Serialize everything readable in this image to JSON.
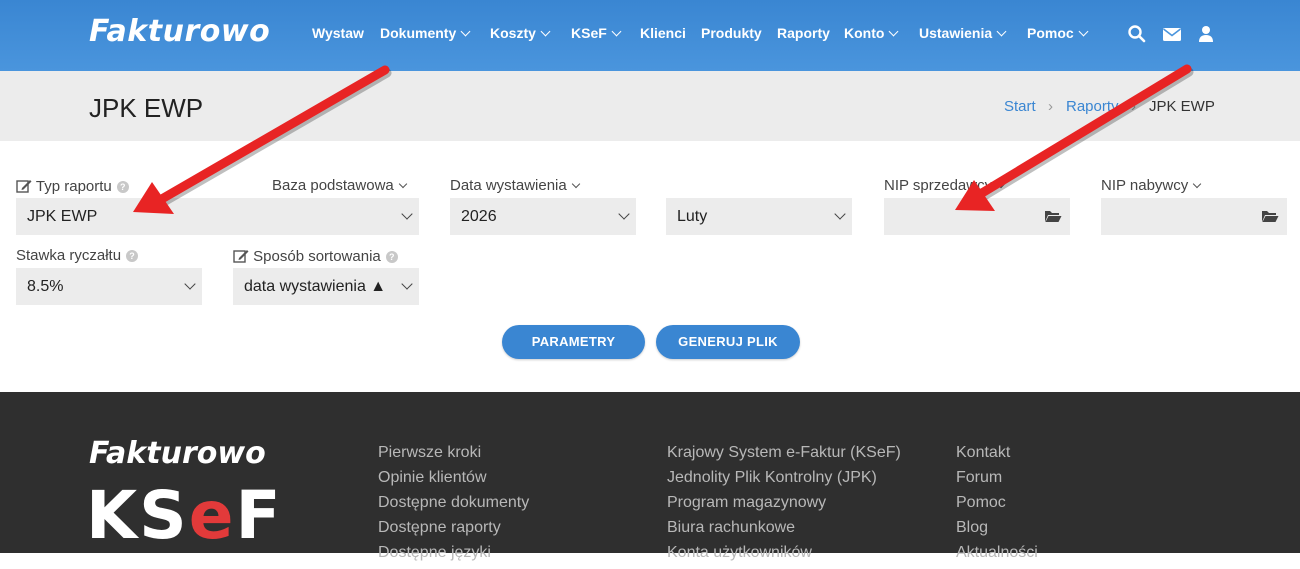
{
  "topbar": {
    "logo": "Fakturowo",
    "nav": [
      {
        "label": "Wystaw",
        "dropdown": false
      },
      {
        "label": "Dokumenty",
        "dropdown": true
      },
      {
        "label": "Koszty",
        "dropdown": true
      },
      {
        "label": "KSeF",
        "dropdown": true
      },
      {
        "label": "Klienci",
        "dropdown": false
      },
      {
        "label": "Produkty",
        "dropdown": false
      },
      {
        "label": "Raporty",
        "dropdown": false
      },
      {
        "label": "Konto",
        "dropdown": true
      },
      {
        "label": "Ustawienia",
        "dropdown": true
      },
      {
        "label": "Pomoc",
        "dropdown": true
      }
    ],
    "icons": [
      "search-icon",
      "envelope-icon",
      "user-icon"
    ]
  },
  "page": {
    "title": "JPK EWP",
    "breadcrumb": [
      "Start",
      "Raporty",
      "JPK EWP"
    ]
  },
  "form": {
    "typ_raportu": {
      "label": "Typ raportu",
      "value": "JPK EWP"
    },
    "baza": {
      "label": "Baza podstawowa"
    },
    "data_wystawienia": {
      "label": "Data wystawienia",
      "year": "2026",
      "month": "Luty"
    },
    "nip_sprzedawcy": {
      "label": "NIP sprzedawcy",
      "value": ""
    },
    "nip_nabywcy": {
      "label": "NIP nabywcy",
      "value": ""
    },
    "stawka": {
      "label": "Stawka ryczałtu",
      "value": "8.5%"
    },
    "sortowanie": {
      "label": "Sposób sortowania",
      "value": "data wystawienia ▲"
    }
  },
  "buttons": {
    "parametry": "PARAMETRY",
    "generuj": "GENERUJ PLIK"
  },
  "footer": {
    "logo": "Fakturowo",
    "ksef": [
      "KS",
      "e",
      "F"
    ],
    "col1": [
      "Pierwsze kroki",
      "Opinie klientów",
      "Dostępne dokumenty",
      "Dostępne raporty",
      "Dostępne języki"
    ],
    "col2": [
      "Krajowy System e-Faktur (KSeF)",
      "Jednolity Plik Kontrolny (JPK)",
      "Program magazynowy",
      "Biura rachunkowe",
      "Konta użytkowników"
    ],
    "col3": [
      "Kontakt",
      "Forum",
      "Pomoc",
      "Blog",
      "Aktualności"
    ]
  },
  "colors": {
    "brand": "#3a86d2",
    "annotation_arrow": "#e82424",
    "footer_bg": "#2f2f2f"
  }
}
